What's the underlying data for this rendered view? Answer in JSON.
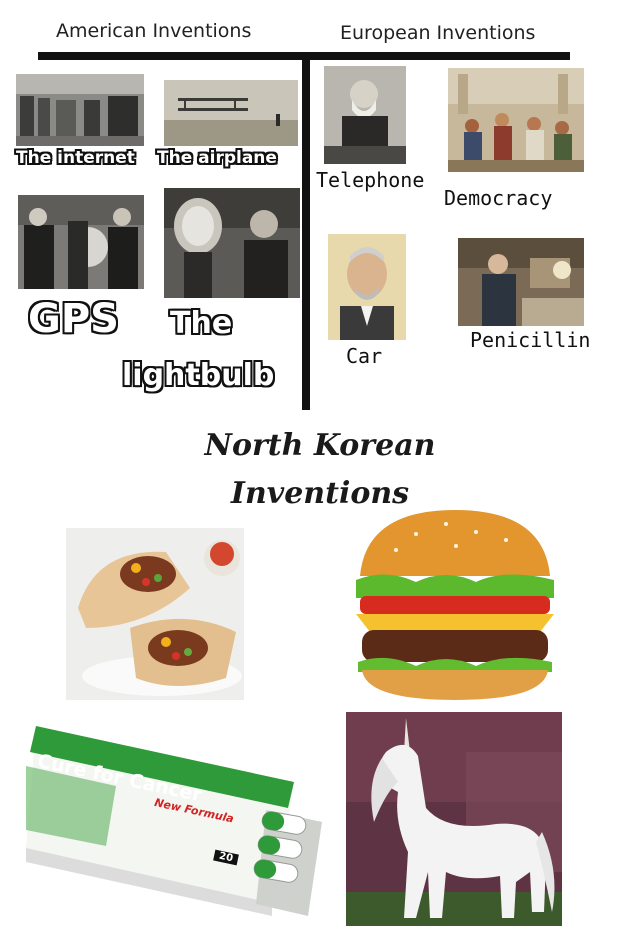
{
  "sections": {
    "american": {
      "header": "American Inventions",
      "items": {
        "internet": "The internet",
        "airplane": "The airplane",
        "gps": "GPS",
        "lightbulb_line1": "The",
        "lightbulb_line2": "lightbulb"
      }
    },
    "european": {
      "header": "European Inventions",
      "items": {
        "telephone": "Telephone",
        "democracy": "Democracy",
        "car": "Car",
        "penicillin": "Penicillin"
      }
    },
    "north_korean": {
      "title_line1": "North Korean",
      "title_line2": "Inventions",
      "pill_box": {
        "headline": "Cure for Cancer",
        "subline": "New Formula",
        "count": "20"
      }
    }
  },
  "colors": {
    "text": "#111111",
    "pill_green": "#2e9a3a"
  }
}
